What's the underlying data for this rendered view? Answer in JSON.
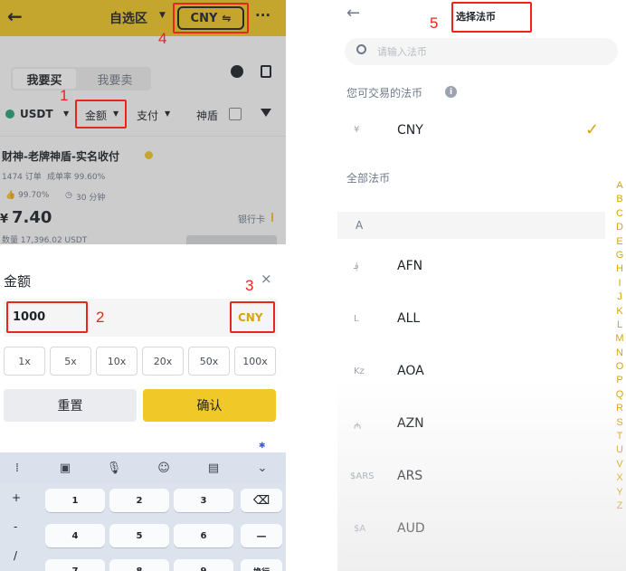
{
  "left": {
    "header": {
      "watchlist_label": "自选区",
      "currency_pill": "CNY",
      "more_label": "···"
    },
    "tabs": {
      "buy": "我要买",
      "sell": "我要卖"
    },
    "filters": {
      "asset": "USDT",
      "amount": "金额",
      "payment": "支付",
      "shield": "神盾"
    },
    "listing": {
      "merchant": "财神-老牌神盾-实名收付",
      "orders": "1474 订单",
      "completion": "成单率 99.60%",
      "positive": "99.70%",
      "time": "30 分钟",
      "price_symbol": "¥",
      "price": "7.40",
      "quantity": "数量  17,396.02 USDT",
      "payment_method": "银行卡"
    },
    "amount_sheet": {
      "title": "金额",
      "close": "×",
      "value": "1000",
      "currency": "CNY",
      "multipliers": [
        "1x",
        "5x",
        "10x",
        "20x",
        "50x",
        "100x"
      ],
      "reset": "重置",
      "confirm": "确认"
    },
    "keyboard": {
      "keys": [
        "1",
        "2",
        "3",
        "4",
        "5",
        "6",
        "7",
        "8",
        "9"
      ],
      "side_left": [
        "+",
        "-",
        "/"
      ],
      "side_right": [
        "⌫",
        "—",
        "换行"
      ]
    },
    "annotations": [
      "1",
      "2",
      "3",
      "4"
    ],
    "colors": {
      "brand_yellow": "#f0c828",
      "gold": "#d9a30b",
      "annotation_red": "#e8261b"
    }
  },
  "right": {
    "back": "←",
    "title": "选择法币",
    "annotation": "5",
    "search_placeholder": "请输入法币",
    "tradable_section": "您可交易的法币",
    "tradable": [
      {
        "symbol": "¥",
        "code": "CNY"
      }
    ],
    "all_section": "全部法币",
    "group_letter": "A",
    "currencies": [
      {
        "symbol": "؋",
        "code": "AFN"
      },
      {
        "symbol": "L",
        "code": "ALL"
      },
      {
        "symbol": "Kz",
        "code": "AOA"
      },
      {
        "symbol": "₼",
        "code": "AZN"
      },
      {
        "symbol": "$ARS",
        "code": "ARS"
      },
      {
        "symbol": "$A",
        "code": "AUD"
      }
    ],
    "index": [
      "A",
      "B",
      "C",
      "D",
      "E",
      "G",
      "H",
      "I",
      "J",
      "K",
      "L",
      "M",
      "N",
      "O",
      "P",
      "Q",
      "R",
      "S",
      "T",
      "U",
      "V",
      "X",
      "Y",
      "Z"
    ]
  }
}
